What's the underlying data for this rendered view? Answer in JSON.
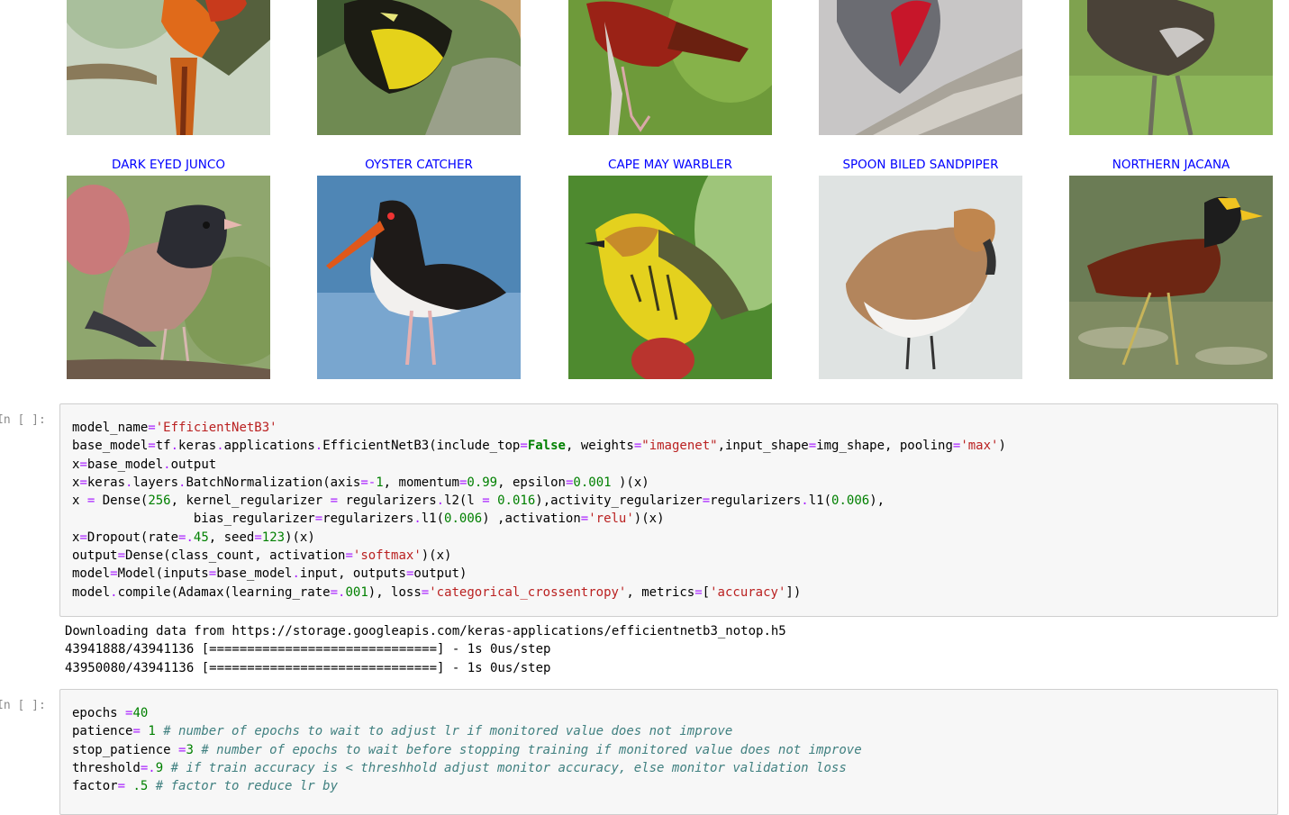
{
  "gallery": {
    "top_row": [
      {
        "name": "partial-bird-1"
      },
      {
        "name": "partial-bird-2"
      },
      {
        "name": "partial-bird-3"
      },
      {
        "name": "partial-bird-4"
      },
      {
        "name": "partial-bird-5"
      }
    ],
    "bottom_row": [
      {
        "title": "DARK EYED JUNCO"
      },
      {
        "title": "OYSTER CATCHER"
      },
      {
        "title": "CAPE MAY WARBLER"
      },
      {
        "title": "SPOON BILED SANDPIPER"
      },
      {
        "title": "NORTHERN JACANA"
      }
    ],
    "title_color": "#0000ff"
  },
  "cells": [
    {
      "prompt": "In [ ]:",
      "lines": [
        [
          [
            "model_name",
            ""
          ],
          [
            "=",
            "op"
          ],
          [
            "'EfficientNetB3'",
            "st"
          ]
        ],
        [
          [
            "base_model",
            ""
          ],
          [
            "=",
            "op"
          ],
          [
            "tf",
            ""
          ],
          [
            ".",
            "op"
          ],
          [
            "keras",
            ""
          ],
          [
            ".",
            "op"
          ],
          [
            "applications",
            ""
          ],
          [
            ".",
            "op"
          ],
          [
            "EfficientNetB3(include_top",
            ""
          ],
          [
            "=",
            "op"
          ],
          [
            "False",
            "kw"
          ],
          [
            ", weights",
            ""
          ],
          [
            "=",
            "op"
          ],
          [
            "\"imagenet\"",
            "st"
          ],
          [
            ",input_shape",
            ""
          ],
          [
            "=",
            "op"
          ],
          [
            "img_shape, pooling",
            ""
          ],
          [
            "=",
            "op"
          ],
          [
            "'max'",
            "st"
          ],
          [
            ")",
            ""
          ]
        ],
        [
          [
            "x",
            ""
          ],
          [
            "=",
            "op"
          ],
          [
            "base_model",
            ""
          ],
          [
            ".",
            "op"
          ],
          [
            "output",
            ""
          ]
        ],
        [
          [
            "x",
            ""
          ],
          [
            "=",
            "op"
          ],
          [
            "keras",
            ""
          ],
          [
            ".",
            "op"
          ],
          [
            "layers",
            ""
          ],
          [
            ".",
            "op"
          ],
          [
            "BatchNormalization(axis",
            ""
          ],
          [
            "=-",
            "op"
          ],
          [
            "1",
            "nu"
          ],
          [
            ", momentum",
            ""
          ],
          [
            "=",
            "op"
          ],
          [
            "0.99",
            "nu"
          ],
          [
            ", epsilon",
            ""
          ],
          [
            "=",
            "op"
          ],
          [
            "0.001",
            "nu"
          ],
          [
            " )(x)",
            ""
          ]
        ],
        [
          [
            "x ",
            ""
          ],
          [
            "=",
            "op"
          ],
          [
            " Dense(",
            ""
          ],
          [
            "256",
            "nu"
          ],
          [
            ", kernel_regularizer ",
            ""
          ],
          [
            "=",
            "op"
          ],
          [
            " regularizers",
            ""
          ],
          [
            ".",
            "op"
          ],
          [
            "l2(l ",
            ""
          ],
          [
            "=",
            "op"
          ],
          [
            " ",
            ""
          ],
          [
            "0.016",
            "nu"
          ],
          [
            "),activity_regularizer",
            ""
          ],
          [
            "=",
            "op"
          ],
          [
            "regularizers",
            ""
          ],
          [
            ".",
            "op"
          ],
          [
            "l1(",
            ""
          ],
          [
            "0.006",
            "nu"
          ],
          [
            "),",
            ""
          ]
        ],
        [
          [
            "                bias_regularizer",
            ""
          ],
          [
            "=",
            "op"
          ],
          [
            "regularizers",
            ""
          ],
          [
            ".",
            "op"
          ],
          [
            "l1(",
            ""
          ],
          [
            "0.006",
            "nu"
          ],
          [
            ") ,activation",
            ""
          ],
          [
            "=",
            "op"
          ],
          [
            "'relu'",
            "st"
          ],
          [
            ")(x)",
            ""
          ]
        ],
        [
          [
            "x",
            ""
          ],
          [
            "=",
            "op"
          ],
          [
            "Dropout(rate",
            ""
          ],
          [
            "=.",
            "op"
          ],
          [
            "45",
            "nu"
          ],
          [
            ", seed",
            ""
          ],
          [
            "=",
            "op"
          ],
          [
            "123",
            "nu"
          ],
          [
            ")(x)",
            ""
          ]
        ],
        [
          [
            "output",
            ""
          ],
          [
            "=",
            "op"
          ],
          [
            "Dense(class_count, activation",
            ""
          ],
          [
            "=",
            "op"
          ],
          [
            "'softmax'",
            "st"
          ],
          [
            ")(x)",
            ""
          ]
        ],
        [
          [
            "model",
            ""
          ],
          [
            "=",
            "op"
          ],
          [
            "Model(inputs",
            ""
          ],
          [
            "=",
            "op"
          ],
          [
            "base_model",
            ""
          ],
          [
            ".",
            "op"
          ],
          [
            "input, outputs",
            ""
          ],
          [
            "=",
            "op"
          ],
          [
            "output)",
            ""
          ]
        ],
        [
          [
            "model",
            ""
          ],
          [
            ".",
            "op"
          ],
          [
            "compile(Adamax(learning_rate",
            ""
          ],
          [
            "=.",
            "op"
          ],
          [
            "001",
            "nu"
          ],
          [
            "), loss",
            ""
          ],
          [
            "=",
            "op"
          ],
          [
            "'categorical_crossentropy'",
            "st"
          ],
          [
            ", metrics",
            ""
          ],
          [
            "=",
            "op"
          ],
          [
            "[",
            ""
          ],
          [
            "'accuracy'",
            "st"
          ],
          [
            "])",
            ""
          ]
        ]
      ],
      "output": [
        "Downloading data from https://storage.googleapis.com/keras-applications/efficientnetb3_notop.h5",
        "43941888/43941136 [==============================] - 1s 0us/step",
        "43950080/43941136 [==============================] - 1s 0us/step"
      ]
    },
    {
      "prompt": "In [ ]:",
      "lines": [
        [
          [
            "epochs ",
            ""
          ],
          [
            "=",
            "op"
          ],
          [
            "40",
            "nu"
          ]
        ],
        [
          [
            "patience",
            ""
          ],
          [
            "=",
            "op"
          ],
          [
            " ",
            ""
          ],
          [
            "1",
            "nu"
          ],
          [
            " ",
            ""
          ],
          [
            "# number of epochs to wait to adjust lr if monitored value does not improve",
            "cm"
          ]
        ],
        [
          [
            "stop_patience ",
            ""
          ],
          [
            "=",
            "op"
          ],
          [
            "3",
            "nu"
          ],
          [
            " ",
            ""
          ],
          [
            "# number of epochs to wait before stopping training if monitored value does not improve",
            "cm"
          ]
        ],
        [
          [
            "threshold",
            ""
          ],
          [
            "=.",
            "op"
          ],
          [
            "9",
            "nu"
          ],
          [
            " ",
            ""
          ],
          [
            "# if train accuracy is < threshhold adjust monitor accuracy, else monitor validation loss",
            "cm"
          ]
        ],
        [
          [
            "factor",
            ""
          ],
          [
            "=",
            "op"
          ],
          [
            " .5 ",
            "nu"
          ],
          [
            "# factor to reduce lr by",
            "cm"
          ]
        ]
      ]
    }
  ]
}
